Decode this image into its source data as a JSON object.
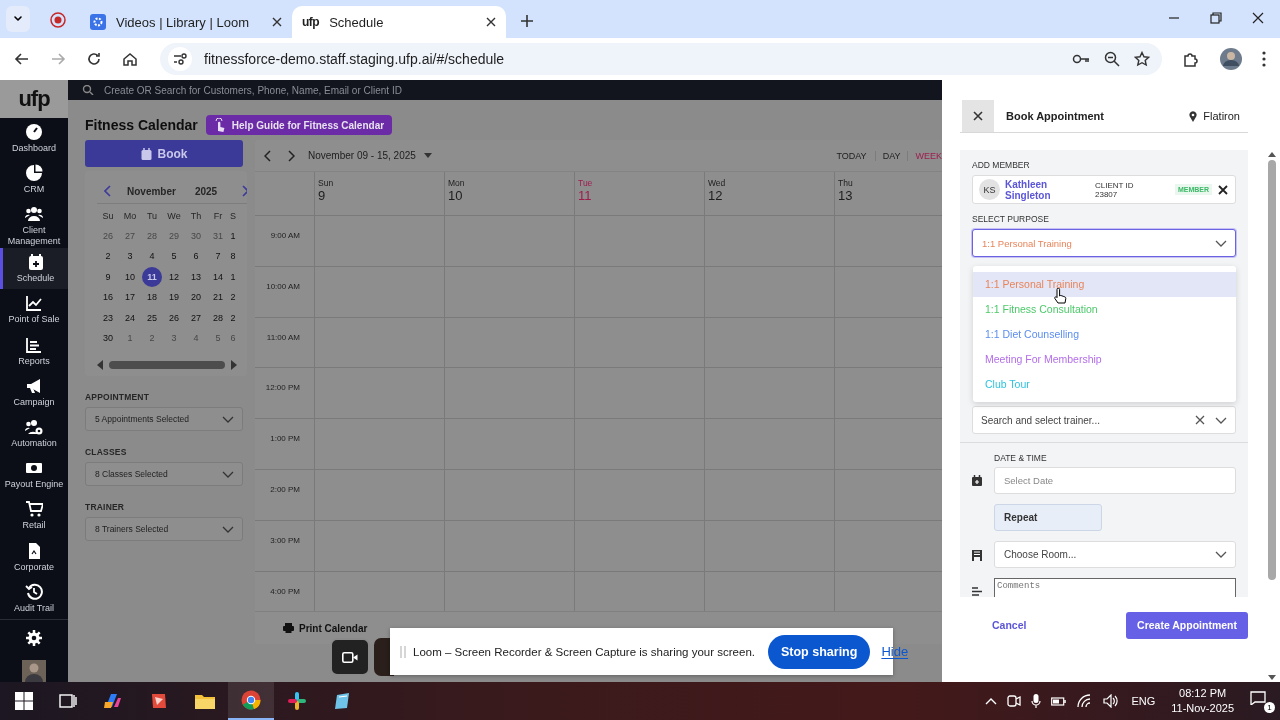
{
  "browser": {
    "tabs": [
      {
        "title": "Videos | Library | Loom",
        "selected": false
      },
      {
        "favicon": "ufp",
        "title": "Schedule",
        "selected": true
      }
    ],
    "url": "fitnessforce-demo.staff.staging.ufp.ai/#/schedule"
  },
  "app": {
    "logo": "ufp",
    "search_placeholder": "Create OR Search for Customers, Phone, Name, Email or Client ID",
    "nav": [
      {
        "label": "Dashboard",
        "selected": false
      },
      {
        "label": "CRM",
        "selected": false
      },
      {
        "label": "Client Management",
        "selected": false
      },
      {
        "label": "Schedule",
        "selected": true
      },
      {
        "label": "Point of Sale",
        "selected": false
      },
      {
        "label": "Reports",
        "selected": false
      },
      {
        "label": "Campaign",
        "selected": false
      },
      {
        "label": "Automation",
        "selected": false
      },
      {
        "label": "Payout Engine",
        "selected": false
      },
      {
        "label": "Retail",
        "selected": false
      },
      {
        "label": "Corporate",
        "selected": false
      },
      {
        "label": "Audit Trail",
        "selected": false
      }
    ]
  },
  "page": {
    "title": "Fitness Calendar",
    "help_button": "Help Guide for Fitness Calendar",
    "book_button": "Book",
    "mini_calendar": {
      "month": "November",
      "year": "2025",
      "weekdays": [
        "Su",
        "Mo",
        "Tu",
        "We",
        "Th",
        "Fr",
        "S"
      ],
      "weeks": [
        [
          {
            "day": "26",
            "muted": true,
            "selected": false
          },
          {
            "day": "27",
            "muted": true,
            "selected": false
          },
          {
            "day": "28",
            "muted": true,
            "selected": false
          },
          {
            "day": "29",
            "muted": true,
            "selected": false
          },
          {
            "day": "30",
            "muted": true,
            "selected": false
          },
          {
            "day": "31",
            "muted": true,
            "selected": false
          },
          {
            "day": "1",
            "muted": false,
            "selected": false
          }
        ],
        [
          {
            "day": "2",
            "muted": false,
            "selected": false
          },
          {
            "day": "3",
            "muted": false,
            "selected": false
          },
          {
            "day": "4",
            "muted": false,
            "selected": false
          },
          {
            "day": "5",
            "muted": false,
            "selected": false
          },
          {
            "day": "6",
            "muted": false,
            "selected": false
          },
          {
            "day": "7",
            "muted": false,
            "selected": false
          },
          {
            "day": "8",
            "muted": false,
            "selected": false
          }
        ],
        [
          {
            "day": "9",
            "muted": false,
            "selected": false
          },
          {
            "day": "10",
            "muted": false,
            "selected": false
          },
          {
            "day": "11",
            "muted": false,
            "selected": true
          },
          {
            "day": "12",
            "muted": false,
            "selected": false
          },
          {
            "day": "13",
            "muted": false,
            "selected": false
          },
          {
            "day": "14",
            "muted": false,
            "selected": false
          },
          {
            "day": "1",
            "muted": false,
            "selected": false
          }
        ],
        [
          {
            "day": "16",
            "muted": false,
            "selected": false
          },
          {
            "day": "17",
            "muted": false,
            "selected": false
          },
          {
            "day": "18",
            "muted": false,
            "selected": false
          },
          {
            "day": "19",
            "muted": false,
            "selected": false
          },
          {
            "day": "20",
            "muted": false,
            "selected": false
          },
          {
            "day": "21",
            "muted": false,
            "selected": false
          },
          {
            "day": "2",
            "muted": false,
            "selected": false
          }
        ],
        [
          {
            "day": "23",
            "muted": false,
            "selected": false
          },
          {
            "day": "24",
            "muted": false,
            "selected": false
          },
          {
            "day": "25",
            "muted": false,
            "selected": false
          },
          {
            "day": "26",
            "muted": false,
            "selected": false
          },
          {
            "day": "27",
            "muted": false,
            "selected": false
          },
          {
            "day": "28",
            "muted": false,
            "selected": false
          },
          {
            "day": "2",
            "muted": false,
            "selected": false
          }
        ],
        [
          {
            "day": "30",
            "muted": false,
            "selected": false
          },
          {
            "day": "1",
            "muted": true,
            "selected": false
          },
          {
            "day": "2",
            "muted": true,
            "selected": false
          },
          {
            "day": "3",
            "muted": true,
            "selected": false
          },
          {
            "day": "4",
            "muted": true,
            "selected": false
          },
          {
            "day": "5",
            "muted": true,
            "selected": false
          },
          {
            "day": "6",
            "muted": true,
            "selected": false
          }
        ]
      ]
    },
    "filters": [
      {
        "label": "APPOINTMENT",
        "value": "5 Appointments Selected"
      },
      {
        "label": "CLASSES",
        "value": "8 Classes Selected"
      },
      {
        "label": "TRAINER",
        "value": "8 Trainers Selected"
      }
    ],
    "week_calendar": {
      "range": "November 09 - 15, 2025",
      "views": [
        {
          "label": "TODAY",
          "selected": false
        },
        {
          "label": "DAY",
          "selected": false
        },
        {
          "label": "WEEK",
          "selected": true
        }
      ],
      "days": [
        {
          "weekday": "Sun",
          "date": "9",
          "today": false
        },
        {
          "weekday": "Mon",
          "date": "10",
          "today": false
        },
        {
          "weekday": "Tue",
          "date": "11",
          "today": true
        },
        {
          "weekday": "Wed",
          "date": "12",
          "today": false
        },
        {
          "weekday": "Thu",
          "date": "13",
          "today": false
        }
      ],
      "times": [
        "9:00 AM",
        "10:00 AM",
        "11:00 AM",
        "12:00 PM",
        "1:00 PM",
        "2:00 PM",
        "3:00 PM",
        "4:00 PM"
      ]
    },
    "print_button": "Print Calendar"
  },
  "booking": {
    "title": "Book Appointment",
    "location": "Flatiron",
    "add_member_label": "ADD MEMBER",
    "member": {
      "initials": "KS",
      "name": "Kathleen Singleton",
      "client_id_label": "CLIENT ID",
      "client_id": "23807",
      "badge": "MEMBER"
    },
    "purpose_label": "SELECT PURPOSE",
    "purpose_value": "1:1 Personal Training",
    "purpose_options": [
      {
        "label": "1:1 Personal Training",
        "color": "#e8845a",
        "selected": true
      },
      {
        "label": "1:1 Fitness Consultation",
        "color": "#4cc96a",
        "selected": false
      },
      {
        "label": "1:1 Diet Counselling",
        "color": "#5b8def",
        "selected": false
      },
      {
        "label": "Meeting For Membership",
        "color": "#b36ee8",
        "selected": false
      },
      {
        "label": "Club Tour",
        "color": "#2ec4e0",
        "selected": false
      }
    ],
    "trainer_placeholder": "Search and select trainer...",
    "date_time_label": "DATE & TIME",
    "date_placeholder": "Select Date",
    "repeat_button": "Repeat",
    "room_placeholder": "Choose Room...",
    "comments_placeholder": "Comments",
    "cancel_button": "Cancel",
    "create_button": "Create Appointment"
  },
  "loom_bar": {
    "message": "Loom – Screen Recorder & Screen Capture is sharing your screen.",
    "stop_button": "Stop sharing",
    "hide_link": "Hide"
  },
  "taskbar": {
    "language": "ENG",
    "time": "08:12 PM",
    "date": "11-Nov-2025",
    "notifications": "1"
  }
}
